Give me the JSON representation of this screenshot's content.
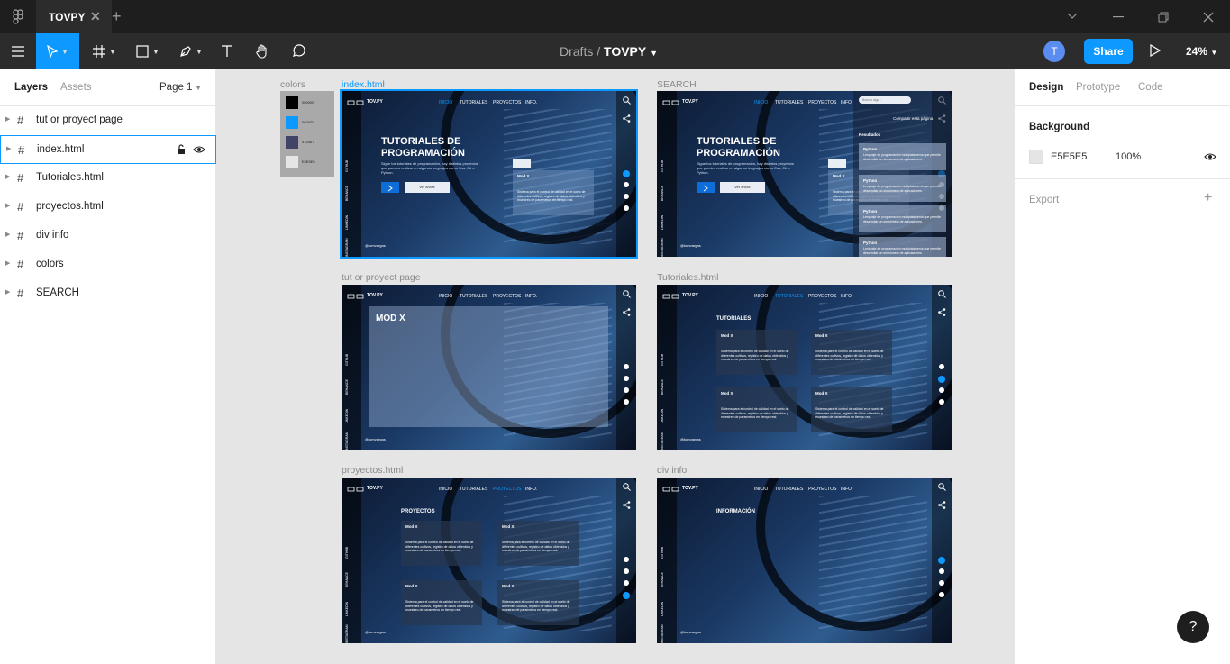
{
  "titlebar": {
    "tab_title": "TOVPY",
    "close": "✕",
    "add": "+"
  },
  "toolbar": {
    "breadcrumb_parent": "Drafts",
    "breadcrumb_sep": "/",
    "file_name": "TOVPY",
    "avatar_initial": "T",
    "share_label": "Share",
    "zoom": "24%"
  },
  "left_panel": {
    "tab_layers": "Layers",
    "tab_assets": "Assets",
    "page_selector": "Page 1",
    "layers": [
      "tut or proyect page",
      "index.html",
      "Tutoriales.html",
      "proyectos.html",
      "div info",
      "colors",
      "SEARCH"
    ]
  },
  "canvas": {
    "frames": {
      "colors": "colors",
      "index": "index.html",
      "search": "SEARCH",
      "tut": "tut or proyect page",
      "tutoriales": "Tutoriales.html",
      "proyectos": "proyectos.html",
      "info": "div info"
    },
    "swatches": [
      {
        "color": "#000000",
        "label": "000000"
      },
      {
        "color": "#0d99ff",
        "label": "0079T9"
      },
      {
        "color": "#414467",
        "label": "414467"
      },
      {
        "color": "#e5e5e5",
        "label": "E5E5E5"
      }
    ],
    "site": {
      "logo": "TOV.PY",
      "nav": [
        "INICIO",
        "TUTORIALES",
        "PROYECTOS",
        "INFO."
      ],
      "hero_line1": "TUTORIALES DE",
      "hero_line2": "PROGRAMACIÓN",
      "hero_sub": "Sigue los tutoriales de programación, hay distintos proyectos que puedes realizar en algunos lenguajes como Css, C# o Python.",
      "cta": "ver ahora",
      "card_title": "Mod X",
      "card_text": "Sistema para el control de calidad en el suelo de diferentes cultivos, registro de datos obtenidos y muestreo de parametros en tiempo real.",
      "social": [
        "GITHUB",
        "BEHANCE",
        "LINKEDIN",
        "INSTAGRAM"
      ],
      "footer": "@tomvargas",
      "search_placeholder": "Buscar algo...",
      "share_page": "Compartir esta página",
      "results": "Resultados",
      "result_title": "Python",
      "result_text": "Lenguaje de programación multiplataforma que permite desarrollar un sin número de aplicaciones.",
      "modx": "MOD X",
      "sec_tutoriales": "TUTORIALES",
      "sec_proyectos": "PROYECTOS",
      "sec_info": "INFORMACIÓN"
    }
  },
  "right_panel": {
    "tab_design": "Design",
    "tab_prototype": "Prototype",
    "tab_code": "Code",
    "background_title": "Background",
    "bg_hex": "E5E5E5",
    "bg_opacity": "100%",
    "export_label": "Export",
    "export_add": "+"
  },
  "help": "?"
}
